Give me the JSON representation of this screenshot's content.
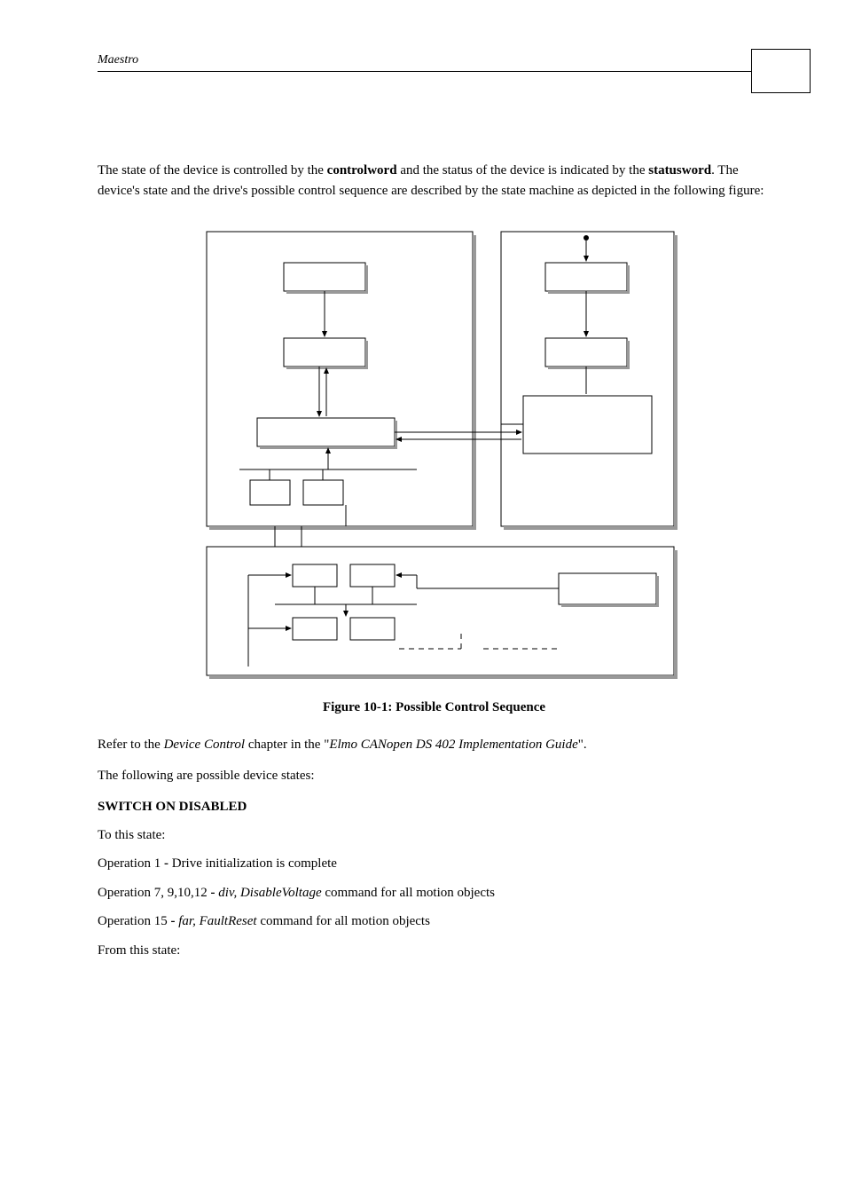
{
  "header": {
    "title": "Maestro"
  },
  "intro": {
    "p1a": "The state of the device is controlled by the ",
    "p1b": "controlword",
    "p1c": " and the status of the device is indicated by the ",
    "p1d": "statusword",
    "p1e": ". The device's state and the drive's possible control sequence are described by the state machine as depicted in the following figure:"
  },
  "caption": "Figure 10-1: Possible Control Sequence",
  "refer": {
    "a": "Refer to the ",
    "b": "Device Control",
    "c": " chapter in the \"",
    "d": "Elmo CANopen DS 402 Implementation Guide",
    "e": "\"."
  },
  "following": "The following are possible device states:",
  "section1": "SWITCH ON DISABLED",
  "to_state": "To this state:",
  "op1": {
    "a": "Operation 1 ",
    "dash": "-",
    "b": " Drive initialization is complete"
  },
  "op2": {
    "a": "Operation 7, 9,10,12 ",
    "dash": "-",
    "b": " div, DisableVoltage",
    "c": " command for all motion objects"
  },
  "op3": {
    "a": "Operation 15 ",
    "dash": "-",
    "b": " far, FaultReset",
    "c": " command for all motion objects"
  },
  "from_state": "From this state:"
}
